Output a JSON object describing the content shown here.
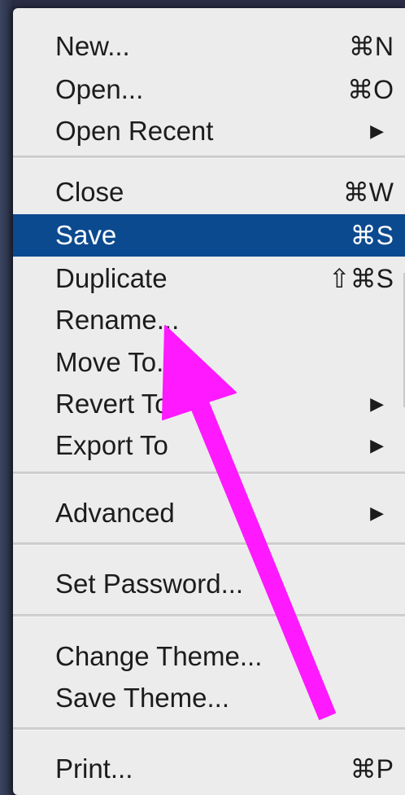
{
  "menu": {
    "groups": [
      {
        "items": [
          {
            "label": "New...",
            "shortcut": "⌘N",
            "submenu": false
          },
          {
            "label": "Open...",
            "shortcut": "⌘O",
            "submenu": false
          },
          {
            "label": "Open Recent",
            "shortcut": "",
            "submenu": true
          }
        ]
      },
      {
        "items": [
          {
            "label": "Close",
            "shortcut": "⌘W",
            "submenu": false
          },
          {
            "label": "Save",
            "shortcut": "⌘S",
            "submenu": false,
            "selected": true
          },
          {
            "label": "Duplicate",
            "shortcut": "⇧⌘S",
            "submenu": false
          },
          {
            "label": "Rename...",
            "shortcut": "",
            "submenu": false
          },
          {
            "label": "Move To...",
            "shortcut": "",
            "submenu": false
          },
          {
            "label": "Revert To",
            "shortcut": "",
            "submenu": true
          },
          {
            "label": "Export To",
            "shortcut": "",
            "submenu": true
          }
        ]
      },
      {
        "items": [
          {
            "label": "Advanced",
            "shortcut": "",
            "submenu": true
          }
        ]
      },
      {
        "items": [
          {
            "label": "Set Password...",
            "shortcut": "",
            "submenu": false
          }
        ]
      },
      {
        "items": [
          {
            "label": "Change Theme...",
            "shortcut": "",
            "submenu": false
          },
          {
            "label": "Save Theme...",
            "shortcut": "",
            "submenu": false
          }
        ]
      },
      {
        "items": [
          {
            "label": "Print...",
            "shortcut": "⌘P",
            "submenu": false
          }
        ]
      }
    ],
    "submenu_icon": "triangle-right-icon",
    "highlight_color": "#0c4a8f"
  },
  "annotation": {
    "icon": "arrow-annotation-icon",
    "color": "#ff19ff"
  }
}
